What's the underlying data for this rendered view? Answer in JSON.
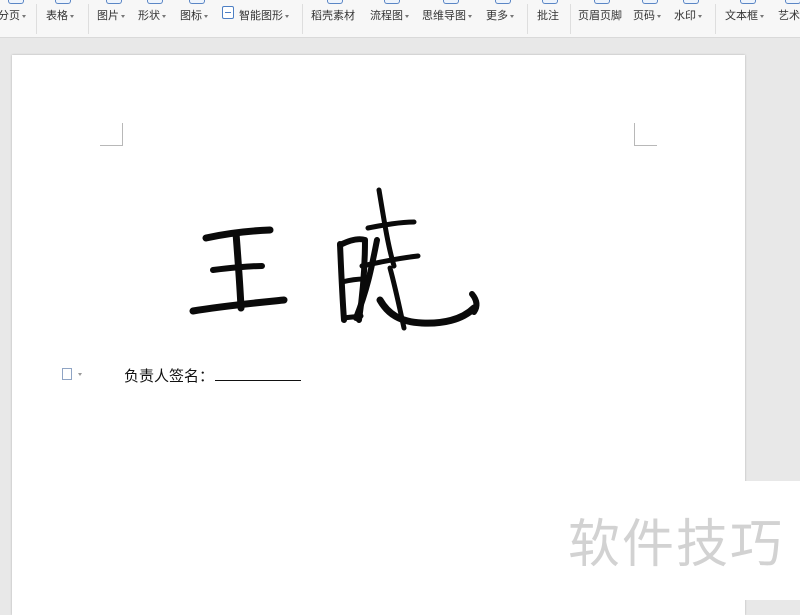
{
  "toolbar": {
    "items": [
      {
        "label": "分页",
        "caret": true
      },
      {
        "label": "表格",
        "caret": true
      },
      {
        "label": "图片",
        "caret": true
      },
      {
        "label": "形状",
        "caret": true
      },
      {
        "label": "图标",
        "caret": true
      },
      {
        "label": "智能图形",
        "caret": true
      },
      {
        "label": "稻壳素材",
        "caret": false
      },
      {
        "label": "流程图",
        "caret": true
      },
      {
        "label": "思维导图",
        "caret": true
      },
      {
        "label": "更多",
        "caret": true
      },
      {
        "label": "批注",
        "caret": false
      },
      {
        "label": "页眉页脚",
        "caret": false
      },
      {
        "label": "页码",
        "caret": true
      },
      {
        "label": "水印",
        "caret": true
      },
      {
        "label": "文本框",
        "caret": true
      },
      {
        "label": "艺术",
        "caret": false
      }
    ]
  },
  "document": {
    "signature_label": "负责人签名：",
    "signature_text": "王晓"
  },
  "watermark": {
    "text": "软件技巧"
  },
  "icons": {
    "paragraph_handle": "document-icon"
  }
}
